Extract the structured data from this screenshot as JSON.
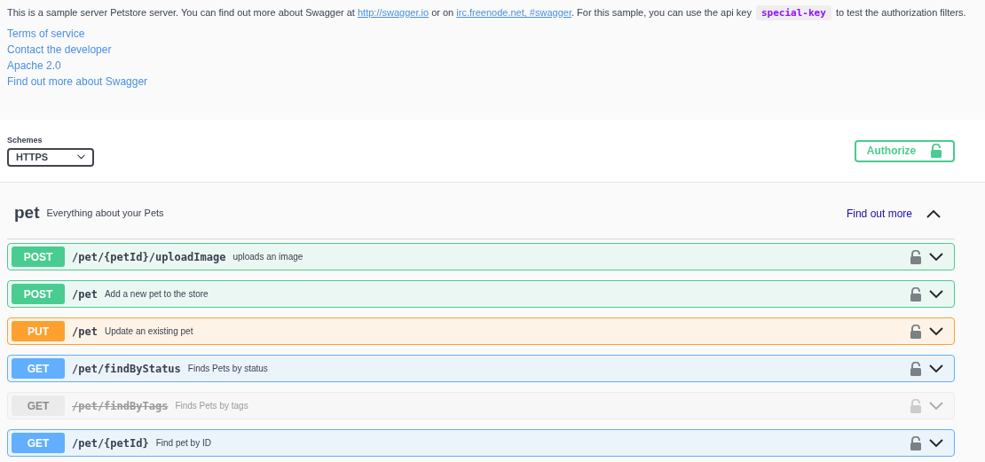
{
  "info": {
    "description_parts": [
      {
        "kind": "text",
        "text": "This is a sample server Petstore server. You can find out more about Swagger at "
      },
      {
        "kind": "link",
        "text": "http://swagger.io"
      },
      {
        "kind": "text",
        "text": " or on "
      },
      {
        "kind": "link",
        "text": "irc.freenode.net, #swagger"
      },
      {
        "kind": "text",
        "text": ". For this sample, you can use the api key "
      },
      {
        "kind": "code",
        "text": "special-key"
      },
      {
        "kind": "text",
        "text": " to test the authorization filters."
      }
    ],
    "links": [
      "Terms of service",
      "Contact the developer",
      "Apache 2.0",
      "Find out more about Swagger"
    ]
  },
  "schemes": {
    "label": "Schemes",
    "value": "HTTPS"
  },
  "authorize": {
    "label": "Authorize"
  },
  "tag": {
    "name": "pet",
    "description": "Everything about your Pets",
    "link": "Find out more",
    "expanded": true,
    "operations": [
      {
        "method": "POST",
        "kind": "post",
        "path": "/pet/{petId}/uploadImage",
        "summary": "uploads an image",
        "deprecated": false
      },
      {
        "method": "POST",
        "kind": "post",
        "path": "/pet",
        "summary": "Add a new pet to the store",
        "deprecated": false
      },
      {
        "method": "PUT",
        "kind": "put",
        "path": "/pet",
        "summary": "Update an existing pet",
        "deprecated": false
      },
      {
        "method": "GET",
        "kind": "get",
        "path": "/pet/findByStatus",
        "summary": "Finds Pets by status",
        "deprecated": false
      },
      {
        "method": "GET",
        "kind": "get",
        "path": "/pet/findByTags",
        "summary": "Finds Pets by tags",
        "deprecated": true
      },
      {
        "method": "GET",
        "kind": "get",
        "path": "/pet/{petId}",
        "summary": "Find pet by ID",
        "deprecated": false
      }
    ]
  }
}
